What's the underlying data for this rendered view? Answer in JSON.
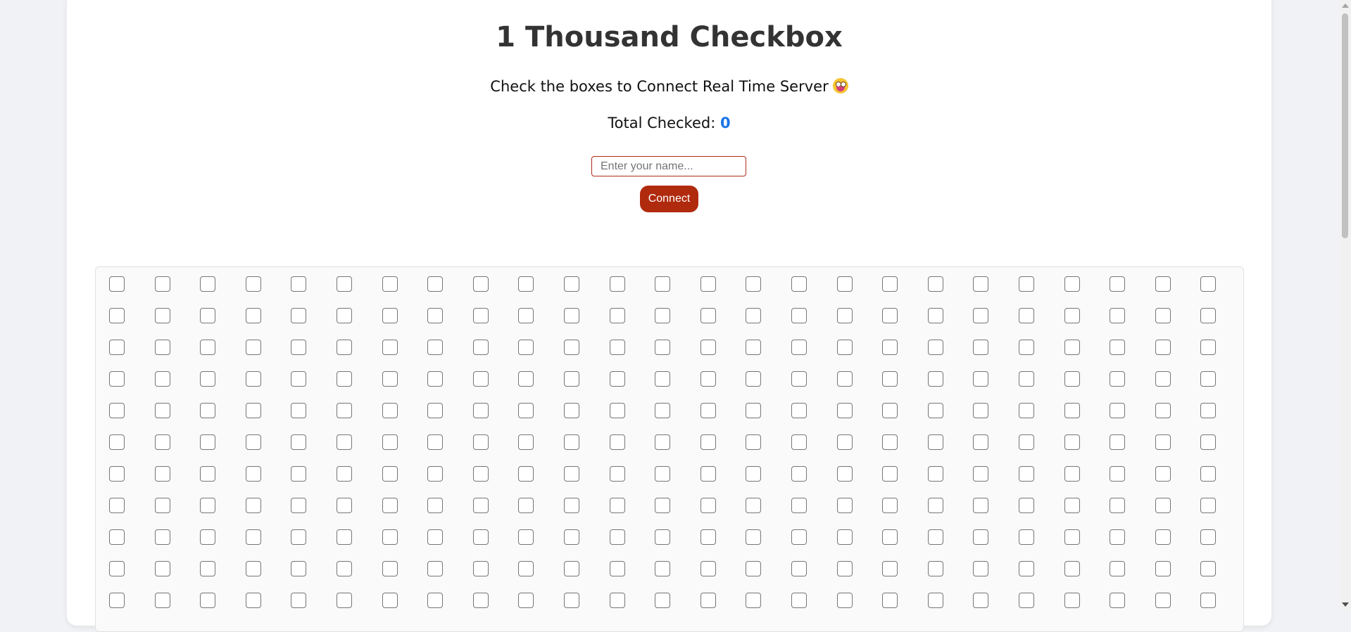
{
  "page": {
    "title": "1 Thousand Checkbox",
    "subtitle": "Check the boxes to Connect Real Time Server",
    "subtitle_emoji": "grinning-tongue-face-emoji",
    "total_label": "Total Checked:",
    "total_count": "0"
  },
  "form": {
    "name_placeholder": "Enter your name...",
    "name_value": "",
    "connect_label": "Connect"
  },
  "checkbox_grid": {
    "columns": 25,
    "visible_rows": 11,
    "checked_count": 0
  },
  "colors": {
    "accent_blue": "#1a73e8",
    "connect_button": "#b02a0e",
    "input_border": "#b02a1b"
  }
}
